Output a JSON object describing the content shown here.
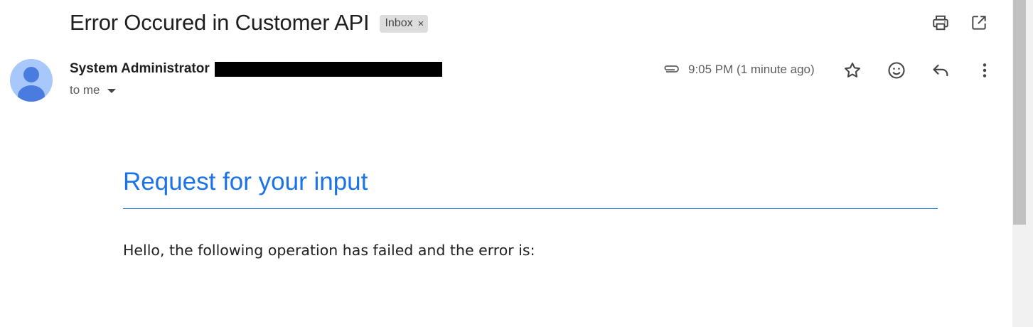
{
  "subject": {
    "title": "Error Occured in Customer API",
    "label": "Inbox",
    "label_remove": "×"
  },
  "top_actions": [
    "print-icon",
    "open-in-new-window-icon"
  ],
  "sender": {
    "name": "System Administrator",
    "to": "to me"
  },
  "meta": {
    "attachment_icon": "paperclip-icon",
    "time": "9:05 PM (1 minute ago)"
  },
  "row_actions": [
    "star-icon",
    "emoji-reaction-icon",
    "reply-icon",
    "more-vert-icon"
  ],
  "body": {
    "heading": "Request for your input",
    "text": "Hello, the following operation has failed and the error is:"
  },
  "colors": {
    "accent": "#1a73e8",
    "avatar_bg": "#a8c7fa",
    "avatar_fg": "#4a7ce0",
    "chip_bg": "#dddddd"
  }
}
